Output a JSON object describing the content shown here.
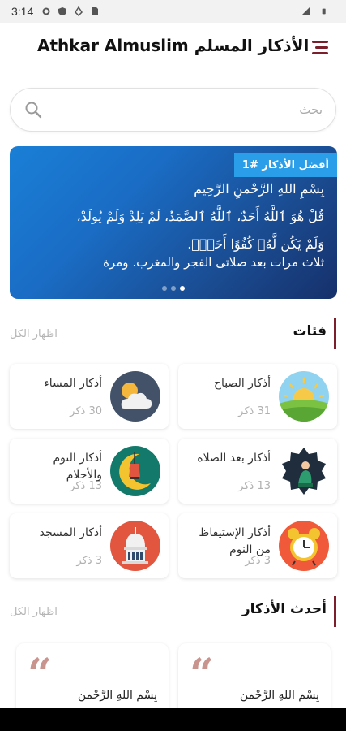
{
  "status_bar": {
    "time": "3:14"
  },
  "app": {
    "title": "Athkar Almuslim الأذكار المسلم"
  },
  "search": {
    "placeholder": "بحث",
    "value": ""
  },
  "banner": {
    "badge": "أفضل الأذكار #1",
    "lines": [
      "بِسْمِ اللهِ الرَّحْمنِ الرَّحِيم",
      "قُلْ هُوَ ٱللَّهُ أَحَدٌ، ٱللَّهُ ٱلصَّمَدُ، لَمْ يَلِدْ وَلَمْ يُولَدْ،",
      "وَلَمْ يَكُن لَّهُۥ كُفُوًا أَحَدٌۢ."
    ],
    "note": "ثلاث مرات بعد صلاتى الفجر والمغرب. ومرة",
    "active_slide": 3,
    "slide_count": 3
  },
  "categories": {
    "title": "فئات",
    "show_all": "اظهار الكل",
    "items": [
      {
        "name": "أذكار الصباح",
        "count": "31 ذكر",
        "icon": "sunrise-icon"
      },
      {
        "name": "أذكار المساء",
        "count": "30 ذكر",
        "icon": "moon-cloud-icon"
      },
      {
        "name": "أذكار بعد الصلاة",
        "count": "13 ذكر",
        "icon": "praying-person-icon"
      },
      {
        "name": "أذكار النوم والأحلام",
        "count": "13 ذكر",
        "icon": "moon-lantern-icon"
      },
      {
        "name": "أذكار الإستيقاظ من النوم",
        "count": "3 ذكر",
        "icon": "alarm-clock-icon"
      },
      {
        "name": "أذكار المسجد",
        "count": "3 ذكر",
        "icon": "mosque-icon"
      }
    ]
  },
  "latest": {
    "title": "أحدث الأذكار",
    "show_all": "اظهار الكل",
    "items": [
      {
        "text": "بِسْمِ اللهِ الرَّحْمنِ"
      },
      {
        "text": "بِسْمِ اللهِ الرَّحْمنِ"
      }
    ]
  },
  "colors": {
    "accent": "#7a1f2b",
    "banner_start": "#1a7fd6",
    "banner_end": "#16306a",
    "badge": "#2a9ee8"
  }
}
